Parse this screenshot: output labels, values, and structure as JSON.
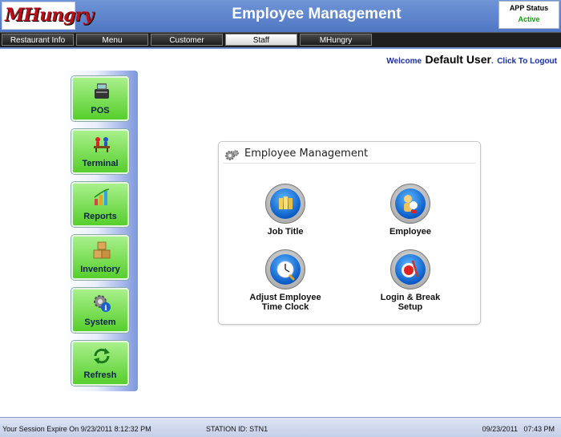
{
  "app": {
    "logo_text": "MHungry",
    "title": "Employee Management"
  },
  "app_status": {
    "label": "APP Status",
    "value": "Active",
    "value_color": "#1a9a1a"
  },
  "nav": {
    "tabs": [
      {
        "label": "Restaurant Info",
        "active": false
      },
      {
        "label": "Menu",
        "active": false
      },
      {
        "label": "Customer",
        "active": false
      },
      {
        "label": "Staff",
        "active": true
      },
      {
        "label": "MHungry",
        "active": false
      }
    ]
  },
  "welcome": {
    "prefix": "Welcome",
    "user": "Default User",
    "sep": ".",
    "logout": "Click To Logout"
  },
  "sidebar": {
    "items": [
      {
        "label": "POS",
        "icon": "pos-register-icon"
      },
      {
        "label": "Terminal",
        "icon": "terminal-icon"
      },
      {
        "label": "Reports",
        "icon": "reports-chart-icon"
      },
      {
        "label": "Inventory",
        "icon": "inventory-boxes-icon"
      },
      {
        "label": "System",
        "icon": "system-gears-icon"
      },
      {
        "label": "Refresh",
        "icon": "refresh-arrows-icon"
      }
    ]
  },
  "panel": {
    "title": "Employee Management",
    "options": [
      {
        "label": "Job Title",
        "icon": "job-title-icon"
      },
      {
        "label": "Employee",
        "icon": "employee-icon"
      },
      {
        "label_line1": "Adjust Employee",
        "label_line2": "Time Clock",
        "icon": "time-clock-icon"
      },
      {
        "label_line1": "Login & Break",
        "label_line2": "Setup",
        "icon": "login-break-icon"
      }
    ]
  },
  "status": {
    "session": "Your Session Expire On 9/23/2011 8:12:32 PM",
    "station": "STATION ID: STN1",
    "datetime": "09/23/2011   07:43 PM"
  },
  "colors": {
    "accent": "#5077c4",
    "nav_bg": "#1f1f1f",
    "button_green": "#56cf2c"
  }
}
